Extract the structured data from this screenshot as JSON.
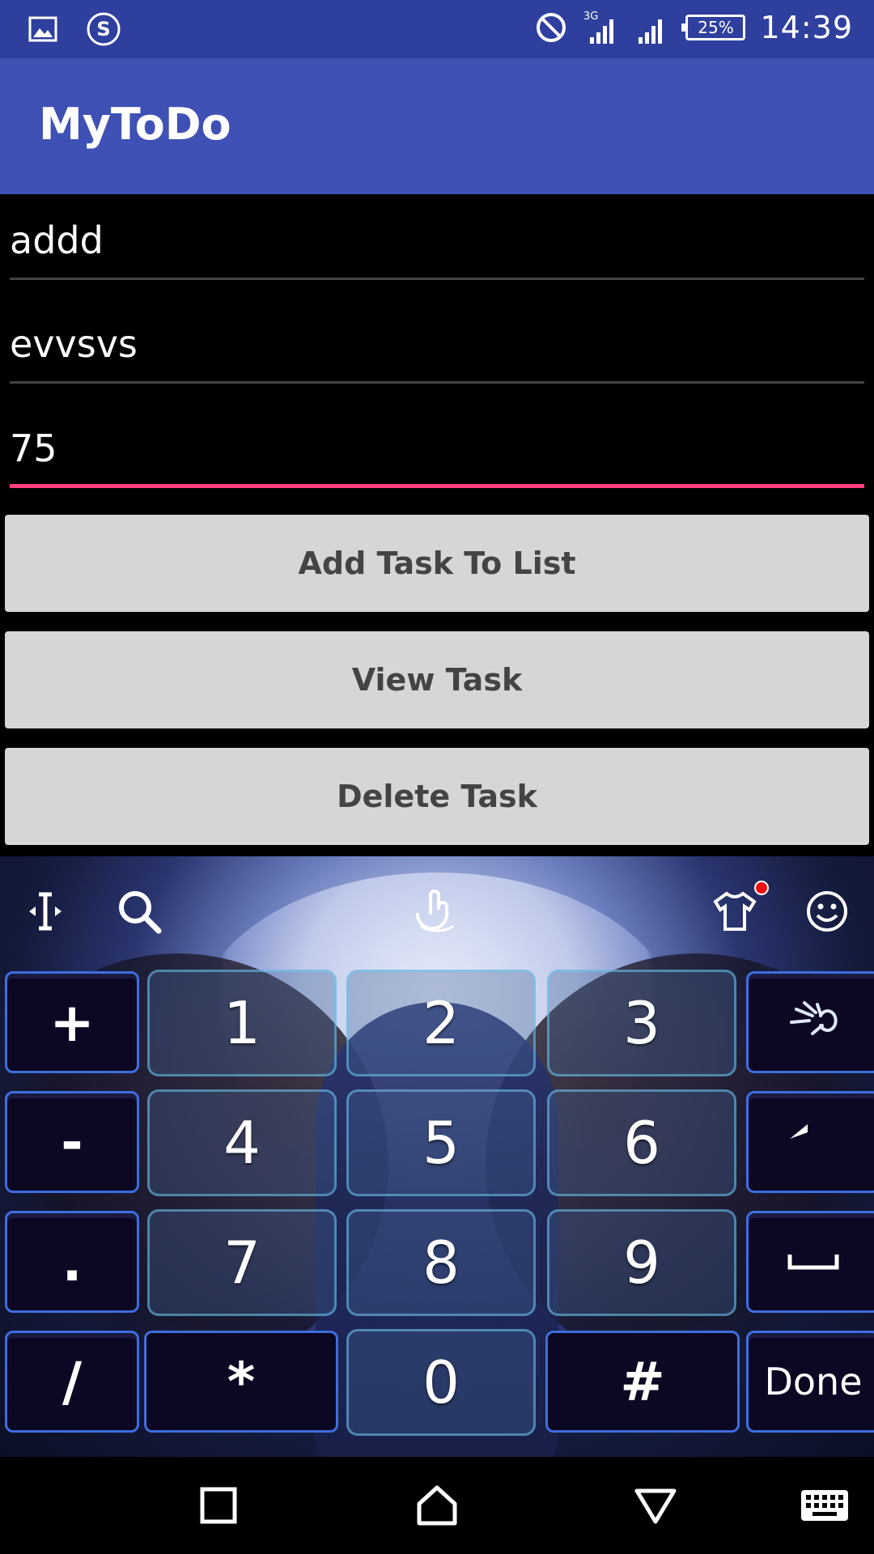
{
  "status_bar": {
    "time": "14:39",
    "battery": "25%",
    "network": "3G",
    "left_icons": [
      "image-icon",
      "s-circle-icon"
    ],
    "right_icons": [
      "do-not-disturb-icon",
      "signal-3g-icon",
      "signal-icon",
      "battery-icon"
    ]
  },
  "app_bar": {
    "title": "MyToDo"
  },
  "form": {
    "field1": {
      "value": "addd"
    },
    "field2": {
      "value": "evvsvs"
    },
    "field3": {
      "value": "75"
    }
  },
  "buttons": {
    "add": "Add Task To List",
    "view": "View Task",
    "delete": "Delete Task"
  },
  "keyboard": {
    "toolbar_icons": [
      "cursor-icon",
      "search-icon",
      "touch-icon",
      "theme-shirt-icon",
      "emoji-icon"
    ],
    "rows": [
      [
        "+",
        "1",
        "2",
        "3",
        "skeleton-hand-icon"
      ],
      [
        "-",
        "4",
        "5",
        "6",
        "back-arrow-icon"
      ],
      [
        ".",
        "7",
        "8",
        "9",
        "space-icon"
      ],
      [
        "/",
        "*",
        "0",
        "#",
        "Done"
      ]
    ],
    "keys": {
      "plus": "+",
      "minus": "-",
      "dot": ".",
      "slash": "/",
      "k1": "1",
      "k2": "2",
      "k3": "3",
      "k4": "4",
      "k5": "5",
      "k6": "6",
      "k7": "7",
      "k8": "8",
      "k9": "9",
      "k0": "0",
      "star": "*",
      "hash": "#",
      "done": "Done"
    }
  },
  "nav_bar": {
    "icons": [
      "recents-icon",
      "home-icon",
      "back-icon",
      "keyboard-icon"
    ]
  },
  "colors": {
    "status_bar": "#2f3f9e",
    "app_bar": "#3f51b5",
    "focus_underline": "#ff4081",
    "button_bg": "#d6d6d6",
    "button_text": "#444444"
  }
}
